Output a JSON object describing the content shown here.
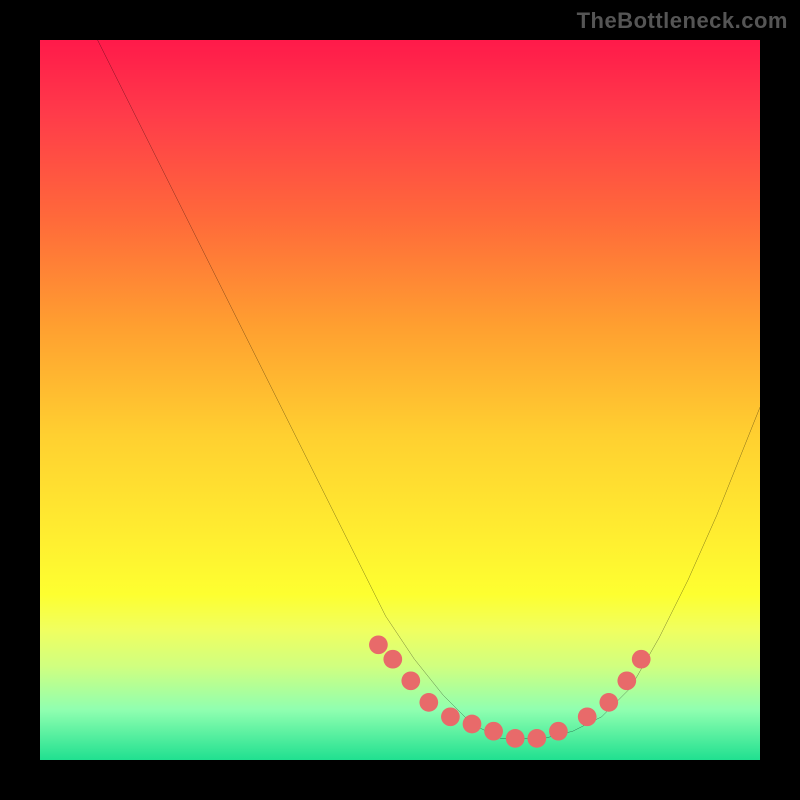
{
  "watermark": "TheBottleneck.com",
  "chart_data": {
    "type": "line",
    "title": "",
    "xlabel": "",
    "ylabel": "",
    "xlim": [
      0,
      100
    ],
    "ylim": [
      0,
      100
    ],
    "series": [
      {
        "name": "bottleneck-curve",
        "x": [
          8,
          12,
          16,
          20,
          24,
          28,
          32,
          36,
          40,
          44,
          48,
          52,
          56,
          60,
          62,
          64,
          66,
          70,
          74,
          78,
          82,
          86,
          90,
          94,
          98,
          100
        ],
        "y": [
          100,
          92,
          84,
          76,
          68,
          60,
          52,
          44,
          36,
          28,
          20,
          14,
          9,
          5,
          4,
          3,
          3,
          3,
          4,
          6,
          10,
          17,
          25,
          34,
          44,
          49
        ]
      }
    ],
    "markers": {
      "name": "highlight-points",
      "x": [
        47,
        49,
        51.5,
        54,
        57,
        60,
        63,
        66,
        69,
        72,
        76,
        79,
        81.5,
        83.5
      ],
      "y": [
        16,
        14,
        11,
        8,
        6,
        5,
        4,
        3,
        3,
        4,
        6,
        8,
        11,
        14
      ]
    },
    "gradient_meaning": "background vertical gradient from red (high bottleneck) at top to green (no bottleneck) at bottom"
  }
}
